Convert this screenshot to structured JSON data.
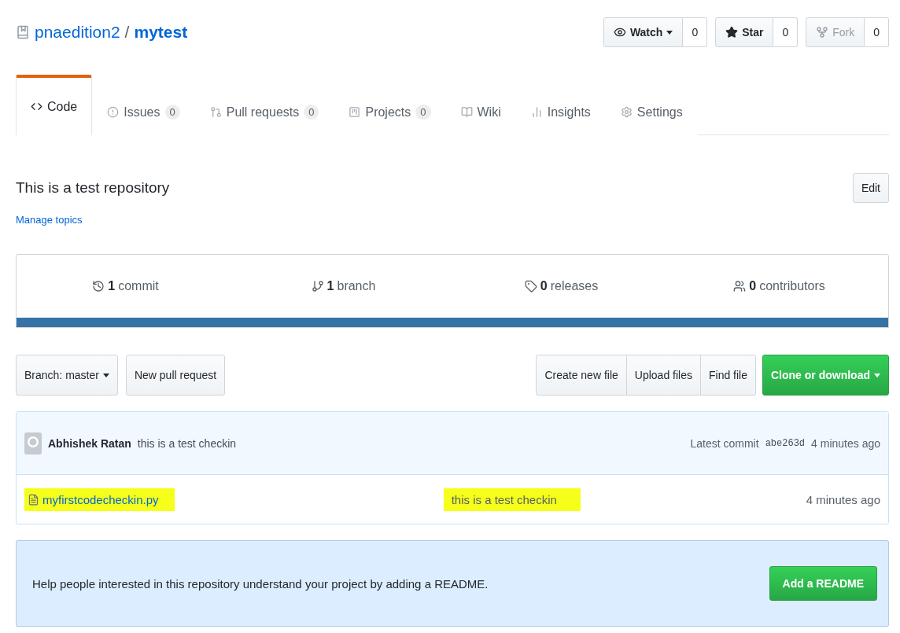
{
  "repo": {
    "owner": "pnaedition2",
    "separator": "/",
    "name": "mytest"
  },
  "actions": [
    {
      "kind": "watch",
      "label": "Watch",
      "count": "0",
      "disabled": false,
      "menu": true
    },
    {
      "kind": "star",
      "label": "Star",
      "count": "0",
      "disabled": false,
      "menu": false
    },
    {
      "kind": "fork",
      "label": "Fork",
      "count": "0",
      "disabled": true,
      "menu": false
    }
  ],
  "tabs": [
    {
      "kind": "code",
      "label": "Code",
      "selected": true
    },
    {
      "kind": "issues",
      "label": "Issues",
      "count": "0",
      "selected": false
    },
    {
      "kind": "pulls",
      "label": "Pull requests",
      "count": "0",
      "selected": false
    },
    {
      "kind": "projects",
      "label": "Projects",
      "count": "0",
      "selected": false
    },
    {
      "kind": "wiki",
      "label": "Wiki",
      "selected": false
    },
    {
      "kind": "insights",
      "label": "Insights",
      "selected": false
    },
    {
      "kind": "settings",
      "label": "Settings",
      "selected": false
    }
  ],
  "description": "This is a test repository",
  "edit_button": "Edit",
  "manage_topics": "Manage topics",
  "stats": [
    {
      "kind": "commits",
      "number": "1",
      "label": "commit"
    },
    {
      "kind": "branches",
      "number": "1",
      "label": "branch"
    },
    {
      "kind": "releases",
      "number": "0",
      "label": "releases"
    },
    {
      "kind": "contributors",
      "number": "0",
      "label": "contributors"
    }
  ],
  "branch_select": {
    "label": "Branch:",
    "value": "master"
  },
  "new_pull_request": "New pull request",
  "file_buttons": [
    "Create new file",
    "Upload files",
    "Find file"
  ],
  "clone_button": "Clone or download",
  "latest_commit": {
    "author": "Abhishek Ratan",
    "message": "this is a test checkin",
    "prefix": "Latest commit",
    "sha": "abe263d",
    "age": "4 minutes ago"
  },
  "files": [
    {
      "name": "myfirstcodecheckin.py",
      "message": "this is a test checkin",
      "age": "4 minutes ago",
      "highlighted": true
    }
  ],
  "readme_prompt": {
    "text": "Help people interested in this repository understand your project by adding a README.",
    "button": "Add a README"
  }
}
